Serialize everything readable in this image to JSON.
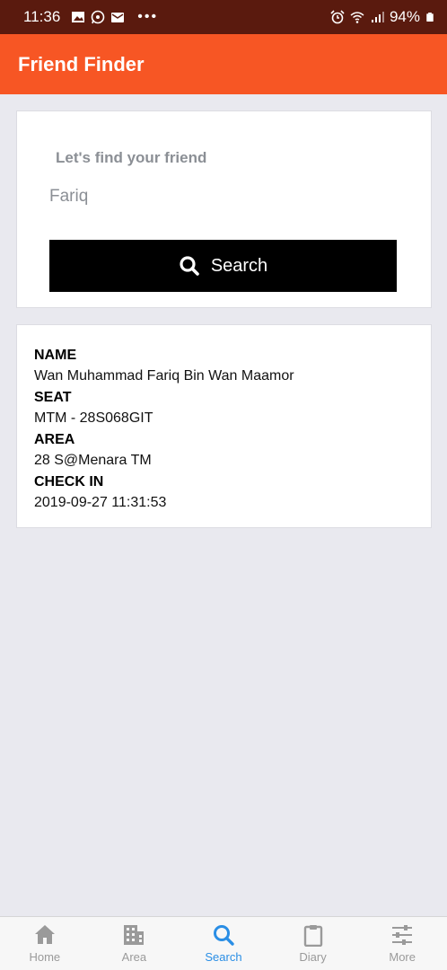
{
  "status_bar": {
    "time": "11:36",
    "battery": "94%",
    "left_icons": [
      "image-icon",
      "whatsapp-icon",
      "mail-icon",
      "more-dots-icon"
    ],
    "right_icons": [
      "alarm-icon",
      "wifi-icon",
      "signal-icon",
      "battery-icon"
    ]
  },
  "app_bar": {
    "title": "Friend Finder",
    "color": "#f75624"
  },
  "search": {
    "label": "Let's find your friend",
    "value": "Fariq",
    "button_label": "Search"
  },
  "result": {
    "name_label": "NAME",
    "name_value": "Wan Muhammad Fariq Bin Wan Maamor",
    "seat_label": "SEAT",
    "seat_value": "MTM - 28S068GIT",
    "area_label": "AREA",
    "area_value": "28 S@Menara TM",
    "checkin_label": "CHECK IN",
    "checkin_value": "2019-09-27 11:31:53"
  },
  "bottom_nav": {
    "active": "Search",
    "active_color": "#2a8ee5",
    "items": [
      {
        "label": "Home",
        "icon": "home-icon"
      },
      {
        "label": "Area",
        "icon": "building-icon"
      },
      {
        "label": "Search",
        "icon": "search-icon"
      },
      {
        "label": "Diary",
        "icon": "clipboard-icon"
      },
      {
        "label": "More",
        "icon": "sliders-icon"
      }
    ]
  }
}
